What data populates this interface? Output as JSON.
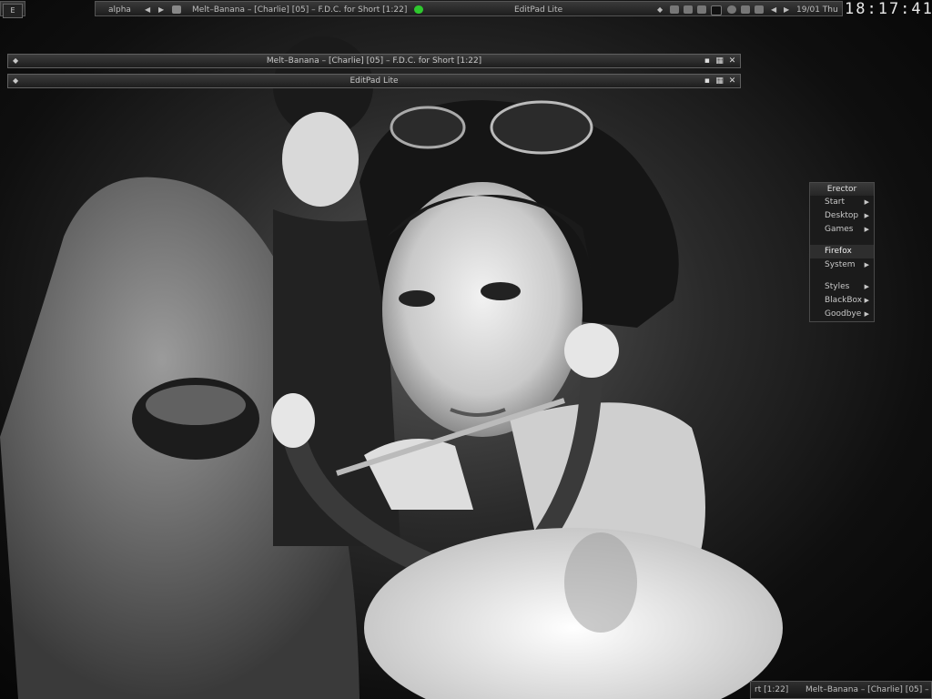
{
  "topbar": {
    "e_button": "E",
    "workspace": "alpha",
    "window_title": "Melt–Banana – [Charlie] [05] – F.D.C. for Short [1:22]",
    "focused_app": "EditPad Lite",
    "date": "19/01 Thu",
    "clock": "18:17:41"
  },
  "windows": [
    {
      "title": "Melt–Banana – [Charlie] [05] – F.D.C. for Short [1:22]"
    },
    {
      "title": "EditPad Lite"
    }
  ],
  "root_menu": {
    "title": "Erector",
    "items": [
      {
        "label": "Start",
        "submenu": true
      },
      {
        "label": "Desktop",
        "submenu": true
      },
      {
        "label": "Games",
        "submenu": true
      },
      {
        "label": "Firefox",
        "submenu": false
      },
      {
        "label": "System",
        "submenu": true
      },
      {
        "label": "Styles",
        "submenu": true
      },
      {
        "label": "BlackBox",
        "submenu": true
      },
      {
        "label": "Goodbye",
        "submenu": true
      }
    ]
  },
  "bottombar": {
    "left_fragment": "rt [1:22]",
    "text": "Melt–Banana – [Charlie] [05] –"
  },
  "colors": {
    "bar_bg": "#262626",
    "border": "#555555",
    "text": "#c8c8c8"
  }
}
